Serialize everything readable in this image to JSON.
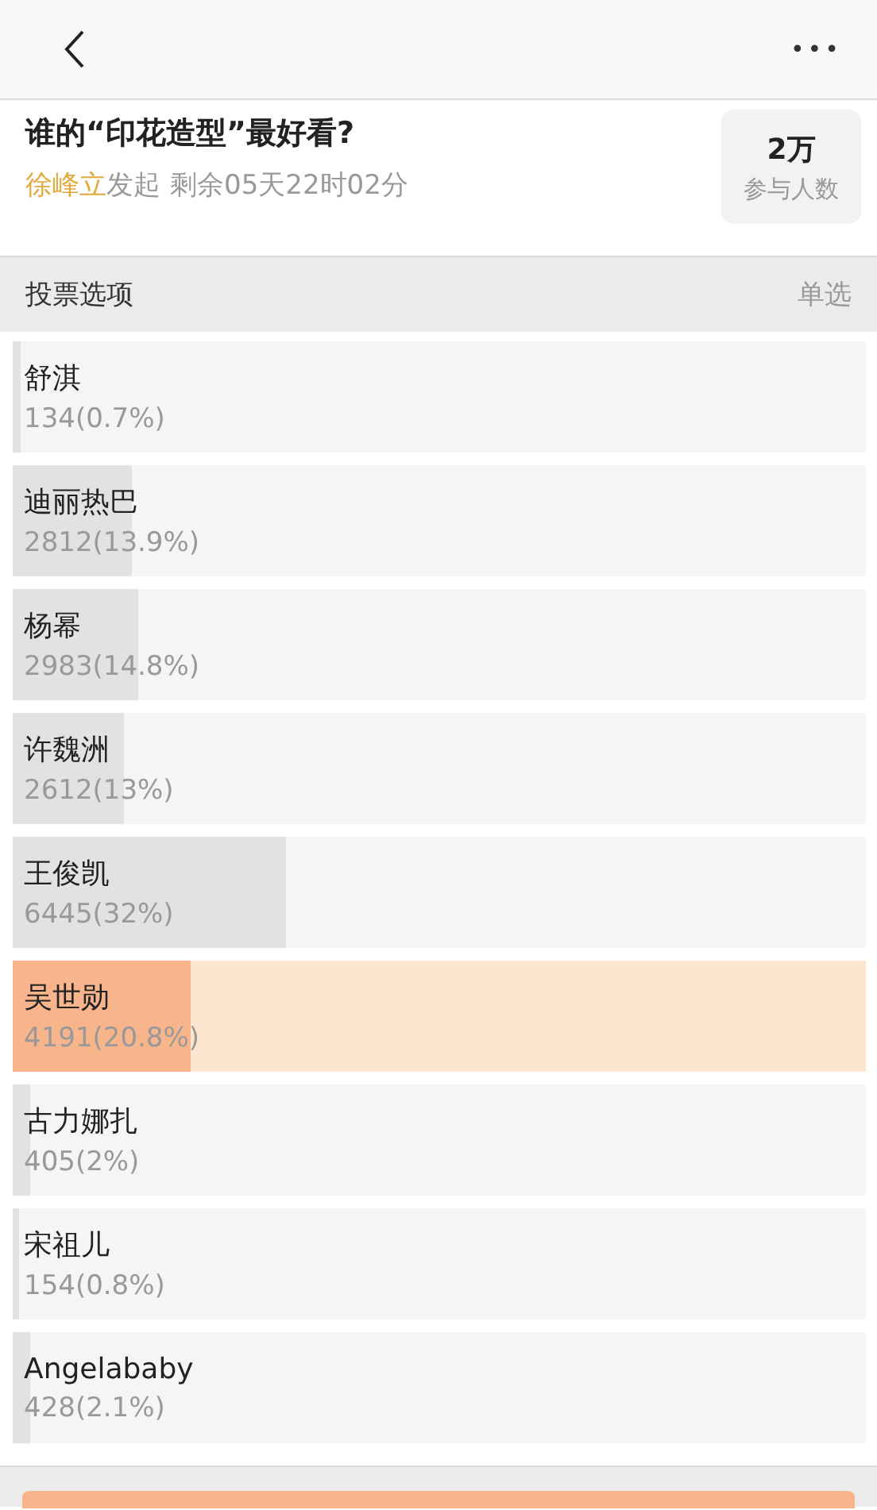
{
  "nav": {
    "more": "•••"
  },
  "poll": {
    "title": "谁的“印花造型”最好看?",
    "author": "徐峰立",
    "author_suffix": "发起",
    "remaining": "剩余05天22时02分",
    "participants": "2万",
    "participants_label": "参与人数"
  },
  "section": {
    "title": "投票选项",
    "mode": "单选"
  },
  "options": [
    {
      "name": "舒淇",
      "result": "134(0.7%)",
      "level": 0.01,
      "selected": false
    },
    {
      "name": "迪丽热巴",
      "result": "2812(13.9%)",
      "level": 0.139,
      "selected": false
    },
    {
      "name": "杨幂",
      "result": "2983(14.8%)",
      "level": 0.148,
      "selected": false
    },
    {
      "name": "许魏洲",
      "result": "2612(13%)",
      "level": 0.13,
      "selected": false
    },
    {
      "name": "王俊凯",
      "result": "6445(32%)",
      "level": 0.32,
      "selected": false
    },
    {
      "name": "吴世勋",
      "result": "4191(20.8%)",
      "level": 0.208,
      "selected": true
    },
    {
      "name": "古力娜扎",
      "result": "405(2%)",
      "level": 0.02,
      "selected": false
    },
    {
      "name": "宋祖儿",
      "result": "154(0.8%)",
      "level": 0.008,
      "selected": false
    },
    {
      "name": "Angelababy",
      "result": "428(2.1%)",
      "level": 0.021,
      "selected": false
    }
  ]
}
